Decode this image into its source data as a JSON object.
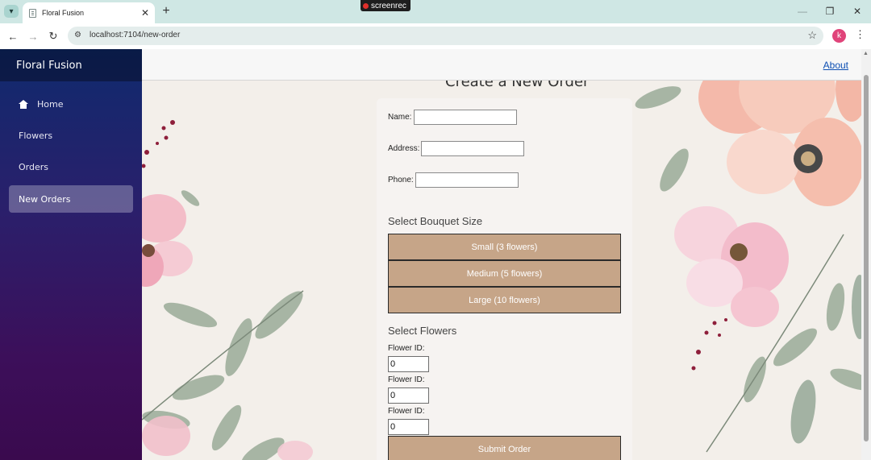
{
  "browser": {
    "tab_title": "Floral Fusion",
    "url": "localhost:7104/new-order",
    "recorder_label": "screenrec",
    "profile_initial": "k",
    "icons": {
      "tab_list": "chevron-down-icon",
      "close_tab": "close-icon",
      "new_tab": "plus-icon",
      "back": "arrow-left-icon",
      "forward": "arrow-right-icon",
      "reload": "reload-icon",
      "site_info": "site-info-icon",
      "bookmark": "star-icon",
      "menu": "kebab-menu-icon"
    }
  },
  "sidebar": {
    "brand": "Floral Fusion",
    "items": [
      {
        "label": "Home",
        "icon": "home-icon",
        "active": false
      },
      {
        "label": "Flowers",
        "active": false
      },
      {
        "label": "Orders",
        "active": false
      },
      {
        "label": "New Orders",
        "active": true
      }
    ]
  },
  "header": {
    "about_link": "About"
  },
  "form": {
    "heading": "Create a New Order",
    "name_label": "Name:",
    "name_value": "",
    "address_label": "Address:",
    "address_value": "",
    "phone_label": "Phone:",
    "phone_value": "",
    "bouquet_title": "Select Bouquet Size",
    "bouquet_sizes": [
      "Small (3 flowers)",
      "Medium (5 flowers)",
      "Large (10 flowers)"
    ],
    "flowers_title": "Select Flowers",
    "flower_fields": [
      {
        "label": "Flower ID:",
        "value": "0"
      },
      {
        "label": "Flower ID:",
        "value": "0"
      },
      {
        "label": "Flower ID:",
        "value": "0"
      }
    ],
    "submit_label": "Submit Order"
  },
  "colors": {
    "accent_button": "#c6a588",
    "link": "#0d4fb3",
    "sidebar_top": "#0f2a6e",
    "sidebar_bottom": "#3a0a4e"
  }
}
